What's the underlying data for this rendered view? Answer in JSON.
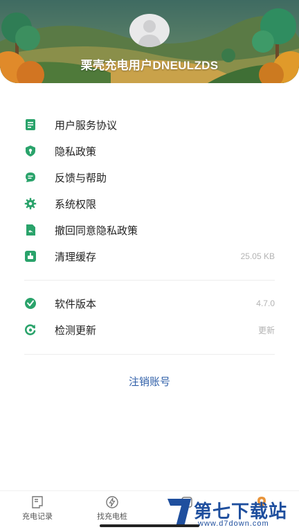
{
  "profile": {
    "username": "栗壳充电用户DNEULZDS"
  },
  "menu": {
    "items": [
      {
        "label": "用户服务协议",
        "icon": "document-icon",
        "value": ""
      },
      {
        "label": "隐私政策",
        "icon": "shield-icon",
        "value": ""
      },
      {
        "label": "反馈与帮助",
        "icon": "message-icon",
        "value": ""
      },
      {
        "label": "系统权限",
        "icon": "gear-icon",
        "value": ""
      },
      {
        "label": "撤回同意隐私政策",
        "icon": "revoke-doc-icon",
        "value": ""
      },
      {
        "label": "清理缓存",
        "icon": "broom-icon",
        "value": "25.05 KB"
      }
    ],
    "items2": [
      {
        "label": "软件版本",
        "icon": "check-badge-icon",
        "value": "4.7.0"
      },
      {
        "label": "检测更新",
        "icon": "refresh-icon",
        "value": "更新"
      }
    ]
  },
  "logout_label": "注销账号",
  "tabbar": {
    "tabs": [
      {
        "label": "充电记录",
        "icon": "receipt-icon"
      },
      {
        "label": "找充电桩",
        "icon": "lightning-icon"
      }
    ]
  },
  "watermark": {
    "text": "第七下载站",
    "url": "www.d7down.com"
  },
  "colors": {
    "accent": "#2aa36b",
    "link": "#2f5fa8"
  }
}
